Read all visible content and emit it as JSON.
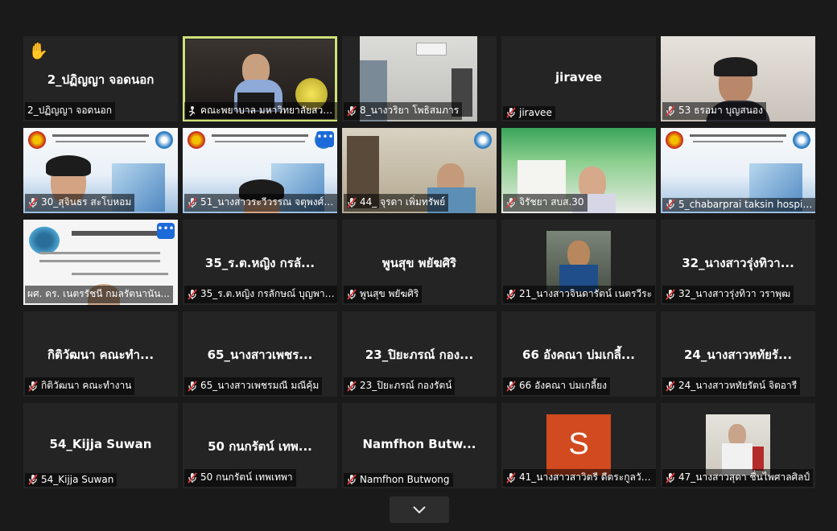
{
  "participants": [
    {
      "big": "2_ปฏิญญา จอดนอก",
      "label": "2_ปฏิญญา จอดนอก",
      "mic": "none",
      "hand": true
    },
    {
      "big": "",
      "label": "คณะพยาบาล มหาวิทยาลัยสวน...",
      "mic": "speaker",
      "video": "office"
    },
    {
      "big": "",
      "label": "8_นางวริยา โพธิสมภาร",
      "mic": "muted",
      "video": "room"
    },
    {
      "big": "jiravee",
      "label": "jiravee",
      "mic": "muted"
    },
    {
      "big": "",
      "label": "53 ธรอมา บุญสนอง",
      "mic": "muted",
      "video": "woman"
    },
    {
      "big": "",
      "label": "30_สุจินธร สะโบหอม",
      "mic": "muted",
      "video": "banner-face"
    },
    {
      "big": "",
      "label": "51_นางสาวระวีวรรณ จตุพงศ์ก...",
      "mic": "muted",
      "video": "banner-face",
      "more": true
    },
    {
      "big": "",
      "label": "44_ จุรดา เพิ่มทรัพย์",
      "mic": "muted",
      "video": "office2"
    },
    {
      "big": "",
      "label": "จิรัชยา สบส.30",
      "mic": "muted",
      "video": "green"
    },
    {
      "big": "",
      "label": "5_chabarprai taksin hospital",
      "mic": "muted",
      "video": "banner"
    },
    {
      "big": "",
      "label": "ผศ. ดร. เนตรรัชนี กมลรัตนานัน...",
      "mic": "none",
      "video": "slide",
      "more": true
    },
    {
      "big": "35_ร.ต.หญิง กรลั...",
      "label": "35_ร.ต.หญิง กรลักษณ์ บุญพาสุข",
      "mic": "muted"
    },
    {
      "big": "พูนสุข พยัฆศิริ",
      "label": "พูนสุข พยัฆศิริ",
      "mic": "muted"
    },
    {
      "big": "",
      "label": "21_นางสาวจินดารัตน์ เนตรวีระ",
      "mic": "muted",
      "video": "avatar-man"
    },
    {
      "big": "32_นางสาวรุ่งทิวา...",
      "label": "32_นางสาวรุ่งทิวา วราพุฒ",
      "mic": "muted"
    },
    {
      "big": "กิติวัฒนา คณะทำ...",
      "label": "กิติวัฒนา คณะทำงาน",
      "mic": "muted"
    },
    {
      "big": "65_นางสาวเพชร...",
      "label": "65_นางสาวเพชรมณี มณีคุ้ม",
      "mic": "muted"
    },
    {
      "big": "23_ปิยะภรณ์ กอง...",
      "label": "23_ปิยะภรณ์ กองรัตน์",
      "mic": "muted"
    },
    {
      "big": "66 อังคณา บ่มเกลี้...",
      "label": "66 อังคณา บ่มเกลี้ยง",
      "mic": "muted"
    },
    {
      "big": "24_นางสาวหทัยรั...",
      "label": "24_นางสาวหทัยรัตน์ จิตอารี",
      "mic": "muted"
    },
    {
      "big": "54_Kijja Suwan",
      "label": "54_Kijja Suwan",
      "mic": "muted"
    },
    {
      "big": "50 กนกรัตน์ เทพ...",
      "label": "50 กนกรัตน์ เทพเทพา",
      "mic": "muted"
    },
    {
      "big": "Namfhon Butw...",
      "label": "Namfhon Butwong",
      "mic": "muted"
    },
    {
      "big": "",
      "label": "41_นางสาวสาวิตรี ดีตระกูลวัฒน...",
      "mic": "muted",
      "video": "letter",
      "letter": "S"
    },
    {
      "big": "",
      "label": "47_นางสาวสุดา ชื่นไพศาลศิลป์",
      "mic": "muted",
      "video": "avatar-woman"
    }
  ],
  "controls": {
    "toggle_icon": "chevron-down-icon"
  },
  "colors": {
    "muted": "#e03a3a",
    "active_border": "#cfe07a",
    "more": "#1c6ad8",
    "letter_bg": "#d24a1f"
  }
}
